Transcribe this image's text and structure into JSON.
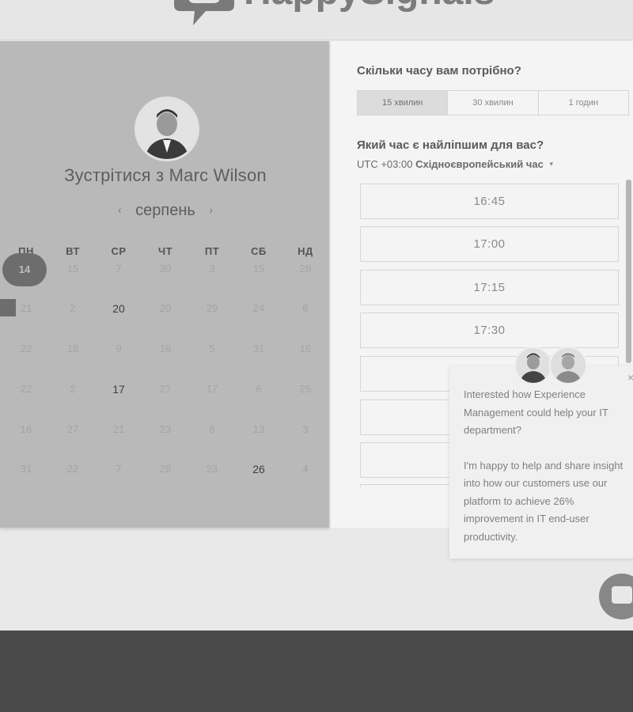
{
  "brand": {
    "logo_text": "HappySignals"
  },
  "host": {
    "meet_title": "Зустрітися з Marc Wilson"
  },
  "calendar": {
    "month": "серпень",
    "weekdays": [
      "ПН",
      "ВТ",
      "СР",
      "ЧТ",
      "ПТ",
      "СБ",
      "НД"
    ],
    "weeks": [
      [
        {
          "t": "14",
          "s": "selected"
        },
        {
          "t": "15",
          "s": "off"
        },
        {
          "t": "7",
          "s": "off"
        },
        {
          "t": "30",
          "s": "off"
        },
        {
          "t": "3",
          "s": "off"
        },
        {
          "t": "15",
          "s": "off"
        },
        {
          "t": "28",
          "s": "off"
        }
      ],
      [
        {
          "t": "21",
          "s": "off"
        },
        {
          "t": "2",
          "s": "off"
        },
        {
          "t": "20",
          "s": "avail"
        },
        {
          "t": "20",
          "s": "off"
        },
        {
          "t": "29",
          "s": "off"
        },
        {
          "t": "24",
          "s": "off"
        },
        {
          "t": "6",
          "s": "off"
        }
      ],
      [
        {
          "t": "22",
          "s": "off"
        },
        {
          "t": "18",
          "s": "off"
        },
        {
          "t": "9",
          "s": "off"
        },
        {
          "t": "16",
          "s": "off"
        },
        {
          "t": "5",
          "s": "off"
        },
        {
          "t": "31",
          "s": "off"
        },
        {
          "t": "16",
          "s": "off"
        }
      ],
      [
        {
          "t": "22",
          "s": "off"
        },
        {
          "t": "2",
          "s": "off"
        },
        {
          "t": "17",
          "s": "avail"
        },
        {
          "t": "27",
          "s": "off"
        },
        {
          "t": "17",
          "s": "off"
        },
        {
          "t": "6",
          "s": "off"
        },
        {
          "t": "25",
          "s": "off"
        }
      ],
      [
        {
          "t": "16",
          "s": "off"
        },
        {
          "t": "27",
          "s": "off"
        },
        {
          "t": "21",
          "s": "off"
        },
        {
          "t": "23",
          "s": "off"
        },
        {
          "t": "6",
          "s": "off"
        },
        {
          "t": "13",
          "s": "off"
        },
        {
          "t": "3",
          "s": "off"
        }
      ],
      [
        {
          "t": "31",
          "s": "off"
        },
        {
          "t": "22",
          "s": "off"
        },
        {
          "t": "7",
          "s": "off"
        },
        {
          "t": "28",
          "s": "off"
        },
        {
          "t": "23",
          "s": "off"
        },
        {
          "t": "26",
          "s": "avail"
        },
        {
          "t": "4",
          "s": "off"
        }
      ]
    ]
  },
  "booking": {
    "duration_question": "Скільки часу вам потрібно?",
    "durations": [
      "15 хвилин",
      "30 хвилин",
      "1 годин"
    ],
    "active_duration": 0,
    "time_question": "Який час є найліпшим для вас?",
    "timezone_offset": "UTC +03:00",
    "timezone_name": "Східноєвропейський час",
    "slots": [
      "16:45",
      "17:00",
      "17:15",
      "17:30",
      "",
      "",
      ""
    ]
  },
  "chat": {
    "message_p1": "Interested how Experience Management could help your IT department?",
    "message_p2": "I'm happy to help and share insight into how our customers use our platform to achieve 26% improvement in IT end-user productivity.",
    "close_icon": "×"
  },
  "icons": {
    "prev": "‹",
    "next": "›",
    "caret": "▾"
  }
}
